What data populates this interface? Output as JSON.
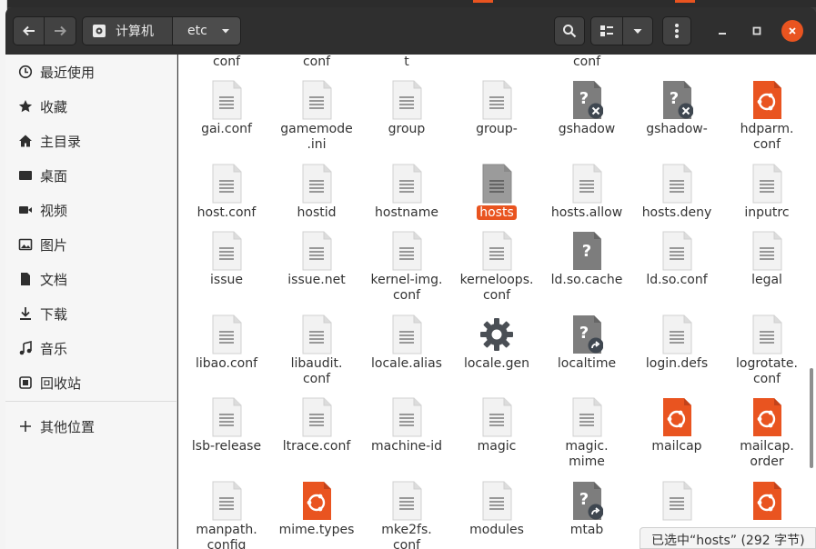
{
  "window": {
    "breadcrumb": {
      "home_label": "计算机",
      "current_label": "etc"
    }
  },
  "sidebar": {
    "items": [
      {
        "label": "最近使用",
        "icon": "clock-icon"
      },
      {
        "label": "收藏",
        "icon": "star-icon"
      },
      {
        "label": "主目录",
        "icon": "home-icon"
      },
      {
        "label": "桌面",
        "icon": "desktop-icon"
      },
      {
        "label": "视频",
        "icon": "video-icon"
      },
      {
        "label": "图片",
        "icon": "picture-icon"
      },
      {
        "label": "文档",
        "icon": "document-icon"
      },
      {
        "label": "下载",
        "icon": "download-icon"
      },
      {
        "label": "音乐",
        "icon": "music-icon"
      },
      {
        "label": "回收站",
        "icon": "trash-icon"
      }
    ],
    "other_locations": {
      "label": "其他位置",
      "icon": "plus-icon"
    }
  },
  "partial_top_row": [
    "conf",
    "conf",
    "t",
    "conf"
  ],
  "files": [
    {
      "name": "gai.conf",
      "type": "text"
    },
    {
      "name": "gamemode\n.ini",
      "type": "text"
    },
    {
      "name": "group",
      "type": "text"
    },
    {
      "name": "group-",
      "type": "text"
    },
    {
      "name": "gshadow",
      "type": "locked"
    },
    {
      "name": "gshadow-",
      "type": "locked"
    },
    {
      "name": "hdparm.\nconf",
      "type": "orange"
    },
    {
      "name": "host.conf",
      "type": "text"
    },
    {
      "name": "hostid",
      "type": "text"
    },
    {
      "name": "hostname",
      "type": "text"
    },
    {
      "name": "hosts",
      "type": "text",
      "selected": true
    },
    {
      "name": "hosts.allow",
      "type": "text"
    },
    {
      "name": "hosts.deny",
      "type": "text"
    },
    {
      "name": "inputrc",
      "type": "text"
    },
    {
      "name": "issue",
      "type": "text"
    },
    {
      "name": "issue.net",
      "type": "text"
    },
    {
      "name": "kernel-img.\nconf",
      "type": "text"
    },
    {
      "name": "kerneloops.\nconf",
      "type": "text"
    },
    {
      "name": "ld.so.cache",
      "type": "unknown"
    },
    {
      "name": "ld.so.conf",
      "type": "text"
    },
    {
      "name": "legal",
      "type": "text"
    },
    {
      "name": "libao.conf",
      "type": "text"
    },
    {
      "name": "libaudit.\nconf",
      "type": "text"
    },
    {
      "name": "locale.alias",
      "type": "text"
    },
    {
      "name": "locale.gen",
      "type": "gear"
    },
    {
      "name": "localtime",
      "type": "link"
    },
    {
      "name": "login.defs",
      "type": "text"
    },
    {
      "name": "logrotate.\nconf",
      "type": "text"
    },
    {
      "name": "lsb-release",
      "type": "text"
    },
    {
      "name": "ltrace.conf",
      "type": "text"
    },
    {
      "name": "machine-id",
      "type": "text"
    },
    {
      "name": "magic",
      "type": "text"
    },
    {
      "name": "magic.\nmime",
      "type": "text"
    },
    {
      "name": "mailcap",
      "type": "orange"
    },
    {
      "name": "mailcap.\norder",
      "type": "orange"
    },
    {
      "name": "manpath.\nconfig",
      "type": "text"
    },
    {
      "name": "mime.types",
      "type": "orange"
    },
    {
      "name": "mke2fs.\nconf",
      "type": "text"
    },
    {
      "name": "modules",
      "type": "text"
    },
    {
      "name": "mtab",
      "type": "link"
    },
    {
      "name": "",
      "type": "text"
    },
    {
      "name": "",
      "type": "orange"
    }
  ],
  "status": {
    "text": "已选中“hosts” (292 字节)"
  },
  "colors": {
    "accent": "#e95420",
    "headerbar": "#2f2f2f"
  }
}
